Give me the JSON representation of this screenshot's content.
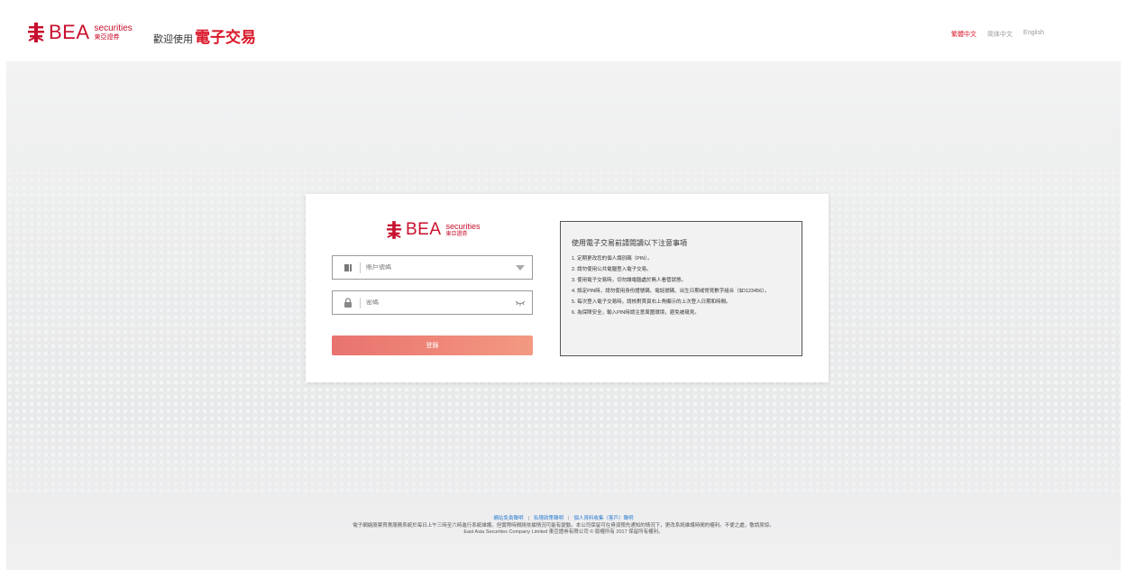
{
  "header": {
    "logo": {
      "brand": "BEA",
      "sub_en": "securities",
      "sub_zh": "東亞證券"
    },
    "welcome_prefix": "歡迎使用",
    "welcome_strong": "電子交易",
    "languages": [
      {
        "label": "繁體中文",
        "active": true
      },
      {
        "label": "简体中文",
        "active": false
      },
      {
        "label": "English",
        "active": false
      }
    ]
  },
  "login": {
    "account_placeholder": "賬戶號碼",
    "password_placeholder": "密碼",
    "login_label": "登錄"
  },
  "notice": {
    "title": "使用電子交易前請閱讀以下注意事項",
    "items": [
      "1. 定期更改您的個人識別碼（PIN）。",
      "2. 請勿使用公共電腦登入電子交易。",
      "3. 使用電子交易時，切勿讓電腦處於無人看管狀態。",
      "4. 設定PIN時，請勿使用身份證號碼、電話號碼、出生日期或常見數字組合（$D123456）。",
      "5. 每次登入電子交易時，請核對首頁右上角顯示的上次登入日期和時間。",
      "6. 為保障安全，輸入PIN時請注意周圍環境，避免被窺見。"
    ]
  },
  "footer": {
    "links": [
      "網站免責聲明",
      "私隱政策聲明",
      "個人資料收集（客戶）聲明"
    ],
    "line1": "電子網絡股票買賣服務系統於每日上午三時至六時進行系統維護。但實際時間將依據情況可能有變動。本公司保留可在毋須預先通知的情況下，更改系統維護時間的權利。不便之處，敬請原諒。",
    "line2": "East Asia Securities Company Limited 東亞證券有限公司 © 版權所有 2017 保留所有權利。"
  }
}
